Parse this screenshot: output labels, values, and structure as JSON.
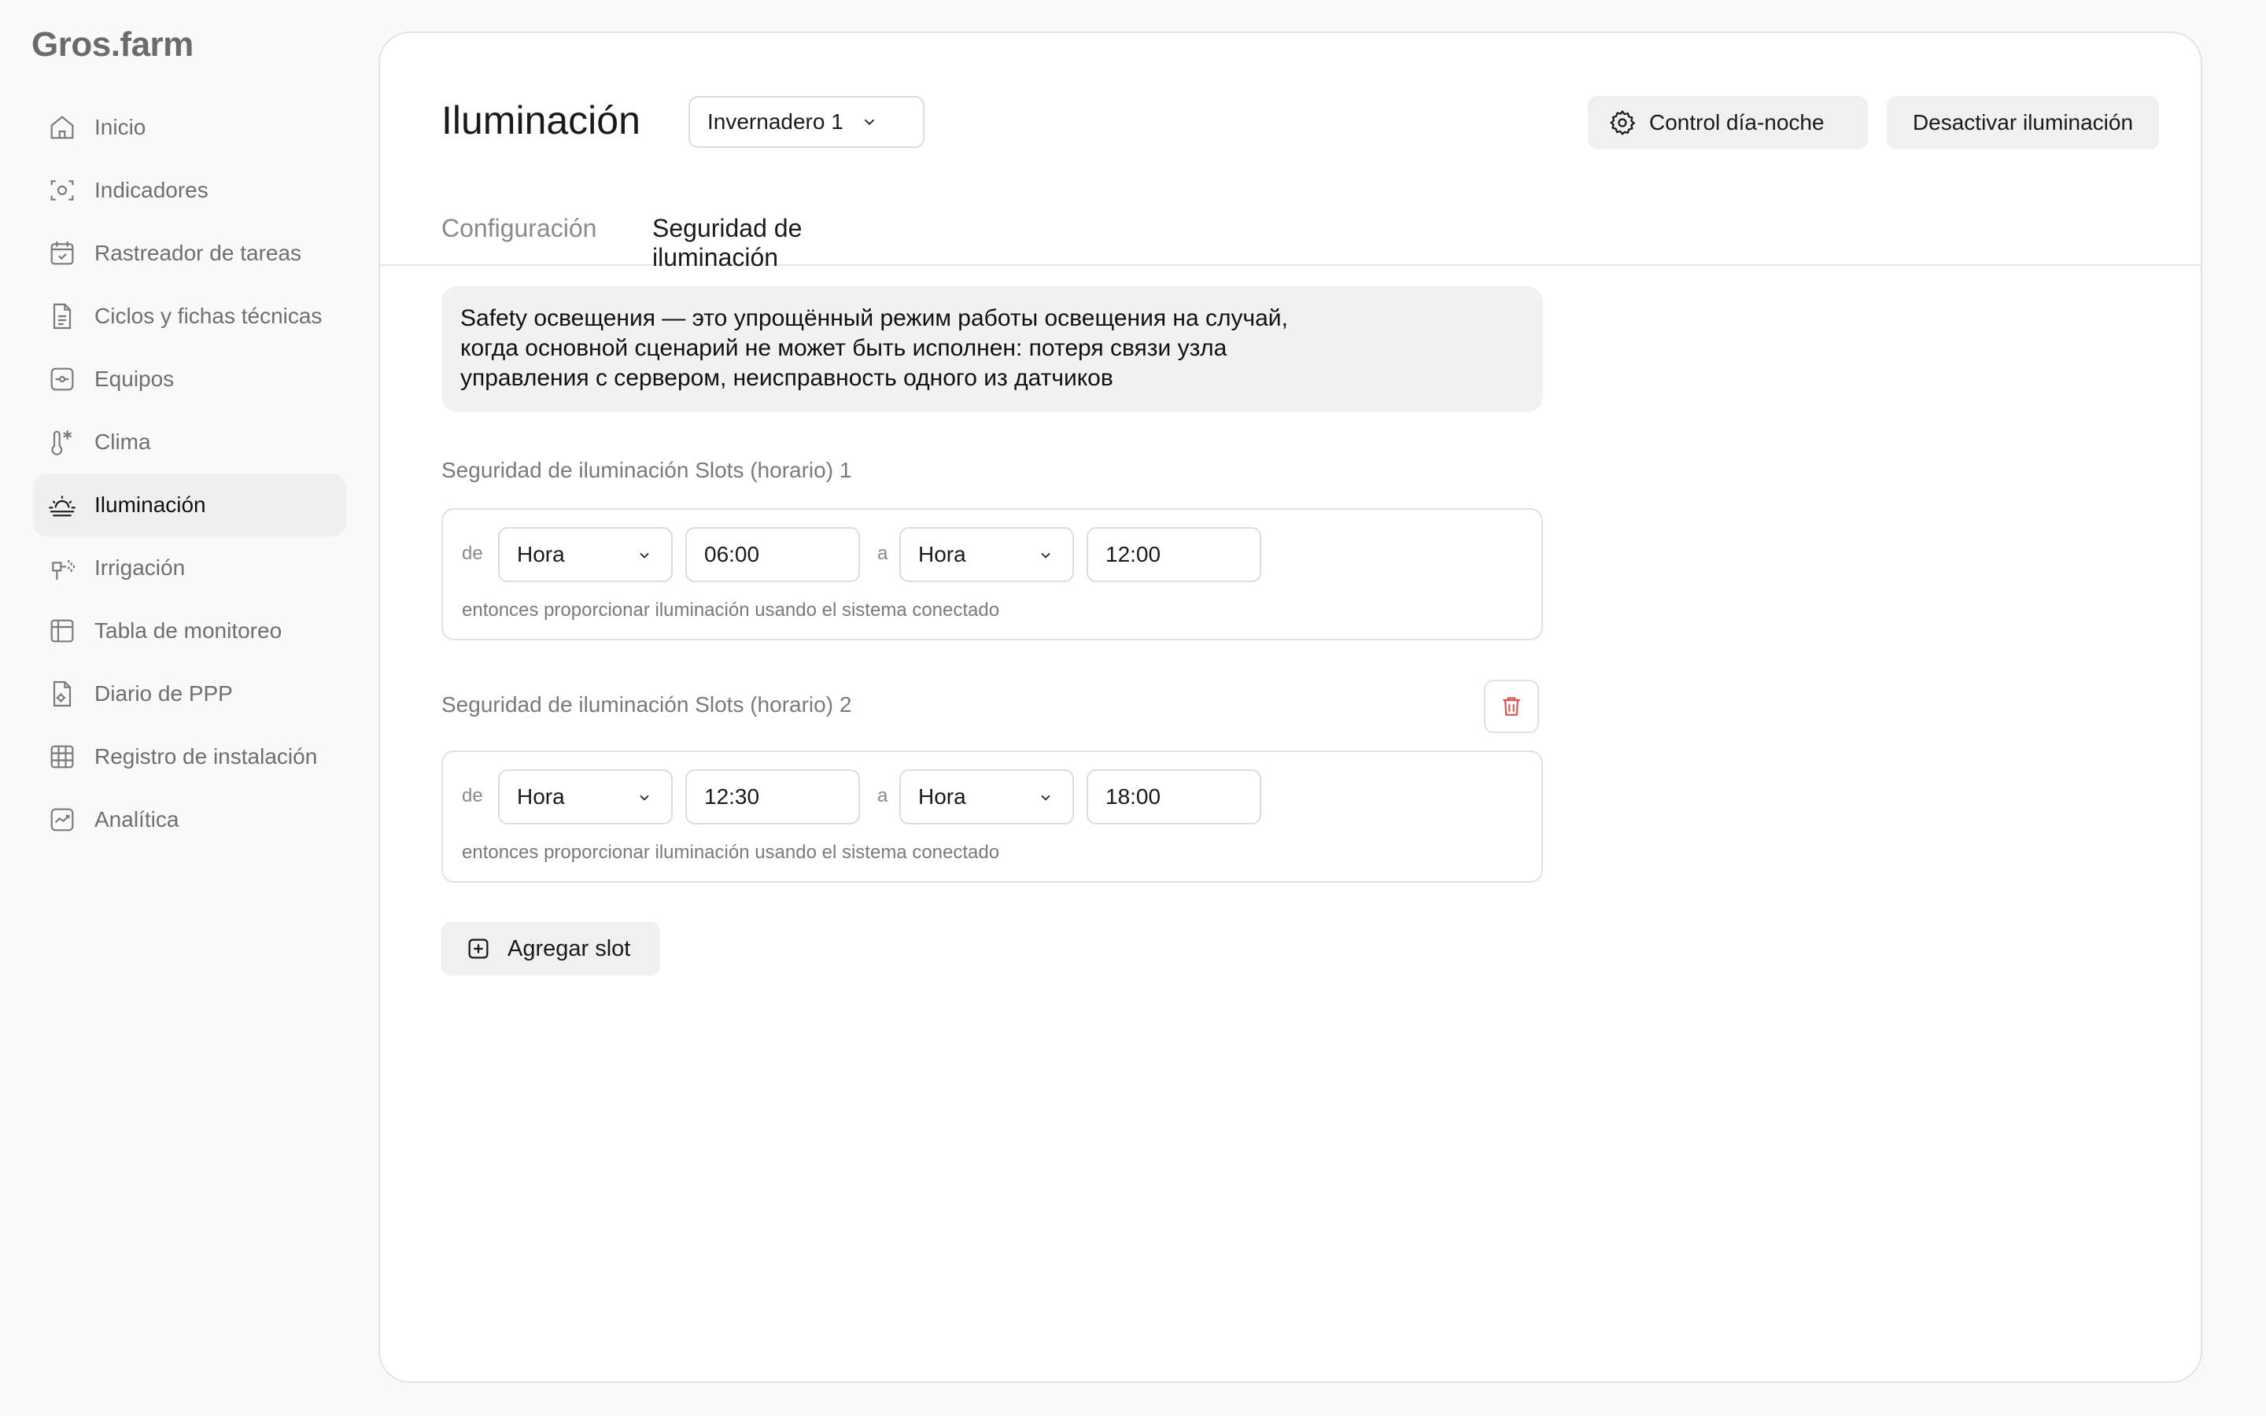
{
  "app": {
    "logo": "Gros.farm"
  },
  "sidebar": {
    "items": [
      {
        "label": "Inicio",
        "icon": "home-icon"
      },
      {
        "label": "Indicadores",
        "icon": "camera-icon"
      },
      {
        "label": "Rastreador de tareas",
        "icon": "calendar-check-icon"
      },
      {
        "label": "Ciclos y fichas técnicas",
        "icon": "document-icon"
      },
      {
        "label": "Equipos",
        "icon": "device-icon"
      },
      {
        "label": "Clima",
        "icon": "thermometer-icon"
      },
      {
        "label": "Iluminación",
        "icon": "sunrise-icon",
        "active": true
      },
      {
        "label": "Irrigación",
        "icon": "sprinkler-icon"
      },
      {
        "label": "Tabla de monitoreo",
        "icon": "table-icon"
      },
      {
        "label": "Diario de PPP",
        "icon": "document-gear-icon"
      },
      {
        "label": "Registro de instalación",
        "icon": "grid-icon"
      },
      {
        "label": "Analítica",
        "icon": "chart-icon"
      }
    ]
  },
  "header": {
    "title": "Iluminación",
    "greenhouse_select": "Invernadero 1",
    "day_night_button": "Control día-noche",
    "disable_button": "Desactivar iluminación"
  },
  "tabs": [
    {
      "label": "Configuración",
      "active": false
    },
    {
      "label": "Seguridad de iluminación",
      "active": true
    }
  ],
  "info": {
    "line1": "Safety освещения — это упрощённый режим работы освещения на случай,",
    "line2": "когда основной сценарий не может быть исполнен: потеря связи узла",
    "line3": "управления с сервером,  неисправность одного из датчиков"
  },
  "slots": [
    {
      "title": "Seguridad de iluminación Slots (horario) 1",
      "from_label": "de",
      "from_unit": "Hora",
      "from_value": "06:00",
      "to_label": "a",
      "to_unit": "Hora",
      "to_value": "12:00",
      "note": "entonces proporcionar iluminación usando el sistema conectado"
    },
    {
      "title": "Seguridad de iluminación Slots (horario) 2",
      "from_label": "de",
      "from_unit": "Hora",
      "from_value": "12:30",
      "to_label": "a",
      "to_unit": "Hora",
      "to_value": "18:00",
      "note": "entonces proporcionar iluminación usando el sistema conectado"
    }
  ],
  "add_slot_button": "Agregar slot",
  "colors": {
    "delete": "#e05050",
    "accent": "#1a1a1a"
  }
}
